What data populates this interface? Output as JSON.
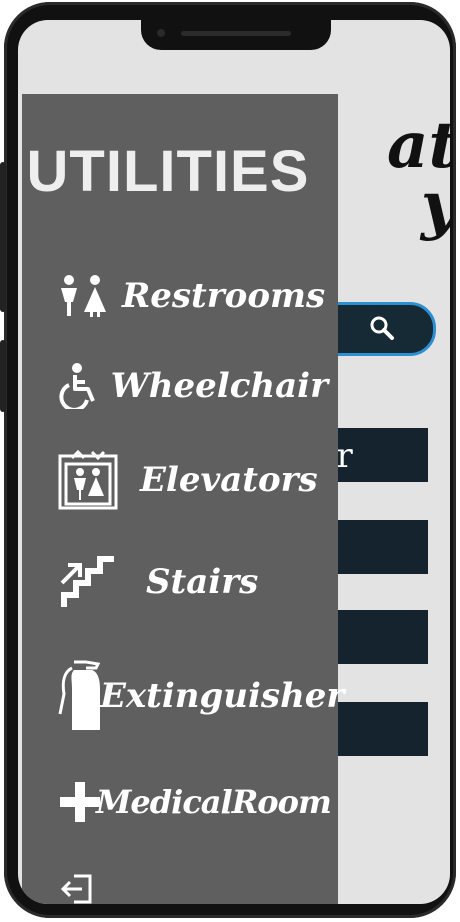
{
  "background_app": {
    "title_lines": [
      "at",
      "y"
    ],
    "row_text": "or"
  },
  "drawer": {
    "title": "UTILITIES",
    "items": [
      {
        "label": "Restrooms",
        "icon": "restroom-icon"
      },
      {
        "label": "Wheelchair",
        "icon": "wheelchair-icon"
      },
      {
        "label": "Elevators",
        "icon": "elevator-icon"
      },
      {
        "label": "Stairs",
        "icon": "stairs-icon"
      },
      {
        "label": "Extinguisher",
        "icon": "fire-extinguisher-icon"
      },
      {
        "label": "MedicalRoom",
        "icon": "plus-icon"
      }
    ],
    "logout_icon": "logout-icon"
  },
  "colors": {
    "drawer_bg": "#5f5f5f",
    "search_border": "#2b8fd2",
    "row_bg": "#14232d"
  }
}
